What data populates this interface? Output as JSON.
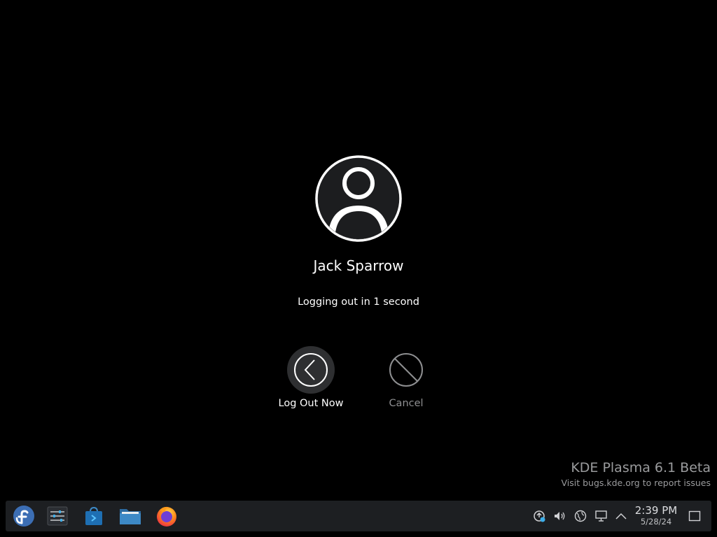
{
  "session": {
    "username": "Jack Sparrow",
    "countdown_text": "Logging out in 1 second"
  },
  "actions": {
    "logout_label": "Log Out Now",
    "cancel_label": "Cancel"
  },
  "watermark": {
    "title": "KDE Plasma 6.1 Beta",
    "subtitle": "Visit bugs.kde.org to report issues"
  },
  "taskbar": {
    "apps": [
      {
        "name": "fedora-launcher-icon"
      },
      {
        "name": "system-settings-icon"
      },
      {
        "name": "discover-store-icon"
      },
      {
        "name": "file-manager-icon"
      },
      {
        "name": "firefox-icon"
      }
    ],
    "tray": [
      {
        "name": "updates-icon"
      },
      {
        "name": "volume-icon"
      },
      {
        "name": "network-icon"
      },
      {
        "name": "display-icon"
      },
      {
        "name": "tray-expand-icon"
      }
    ],
    "clock_time": "2:39 PM",
    "clock_date": "5/28/24"
  },
  "colors": {
    "background": "#000000",
    "panel": "#1d1f22",
    "fedora_blue": "#3c6eb4",
    "folder_blue": "#3d89c6",
    "muted_text": "#9a9b9d"
  }
}
